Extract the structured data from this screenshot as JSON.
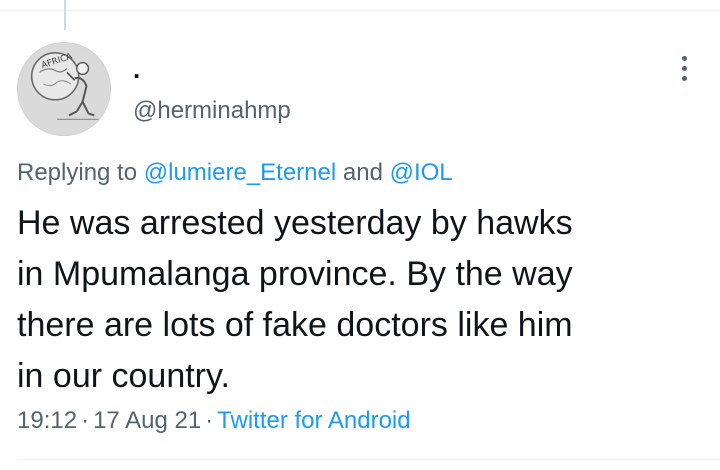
{
  "tweet": {
    "display_name": ".",
    "handle": "@herminahmp",
    "avatar_icon": "africa-globe-carrier-avatar",
    "avatar_text": "AFRICA",
    "more_icon": "more-vertical-icon",
    "reply": {
      "prefix": "Replying to",
      "mention_1": "@lumiere_Eternel",
      "conjunction": "and",
      "mention_2": "@IOL"
    },
    "text_lines": [
      "He was arrested yesterday by hawks",
      "in Mpumalanga province. By the way",
      "there are lots of fake doctors like him",
      "in our country."
    ],
    "time": "19:12",
    "separator": "·",
    "date": "17 Aug 21",
    "source": "Twitter for Android",
    "colors": {
      "link": "#1d9bf0",
      "secondary_text": "#536471",
      "primary_text": "#0f1419"
    }
  }
}
